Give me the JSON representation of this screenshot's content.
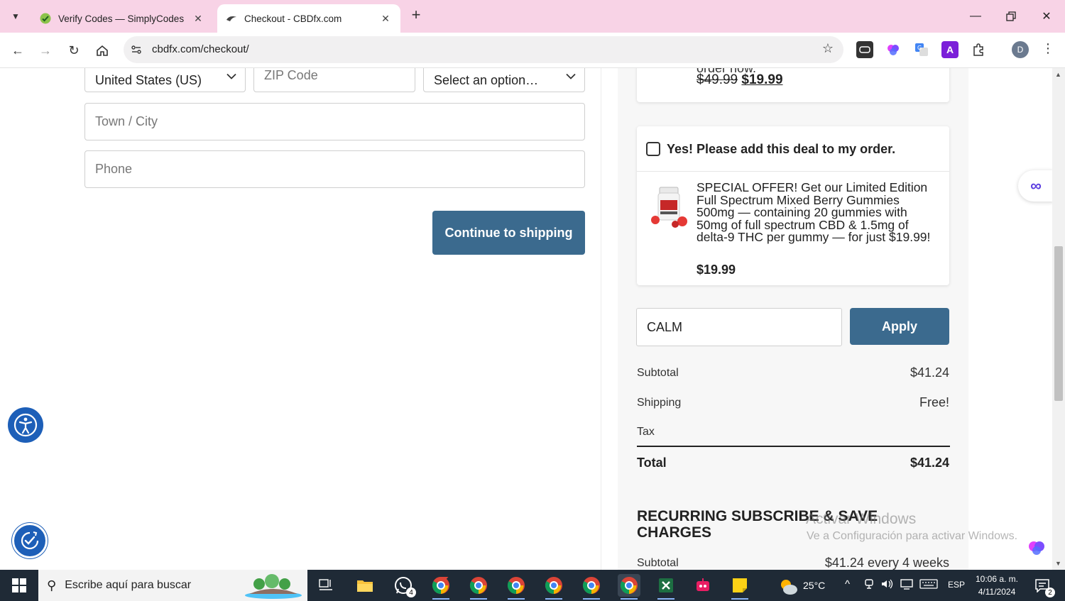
{
  "browser": {
    "tabs": [
      {
        "title": "Verify Codes — SimplyCodes",
        "active": false
      },
      {
        "title": "Checkout - CBDfx.com",
        "active": true
      }
    ],
    "url": "cbdfx.com/checkout/",
    "profile_initial": "D"
  },
  "form": {
    "country_value": "United States (US)",
    "zip_placeholder": "ZIP Code",
    "state_value": "Select an option…",
    "city_placeholder": "Town / City",
    "phone_placeholder": "Phone",
    "continue_label": "Continue to shipping"
  },
  "upsell_top": {
    "partial_text": "order now.",
    "old_price": "$49.99",
    "new_price": "$19.99"
  },
  "deal": {
    "checkbox_label": "Yes! Please add this deal to my order.",
    "description": "SPECIAL OFFER! Get our Limited Edition Full Spectrum Mixed Berry Gummies 500mg — containing 20 gummies with 50mg of full spectrum CBD & 1.5mg of delta-9 THC per gummy — for just $19.99!",
    "price": "$19.99"
  },
  "coupon": {
    "value": "CALM",
    "apply_label": "Apply"
  },
  "summary": {
    "subtotal_label": "Subtotal",
    "subtotal_value": "$41.24",
    "shipping_label": "Shipping",
    "shipping_value": "Free!",
    "tax_label": "Tax",
    "total_label": "Total",
    "total_value": "$41.24"
  },
  "recurring": {
    "title": "RECURRING SUBSCRIBE & SAVE CHARGES",
    "subtotal_label": "Subtotal",
    "subtotal_value": "$41.24 every 4 weeks"
  },
  "watermark": {
    "line1": "Activar Windows",
    "line2": "Ve a Configuración para activar Windows."
  },
  "taskbar": {
    "search_placeholder": "Escribe aquí para buscar",
    "whatsapp_badge": "4",
    "weather": "25°C",
    "language": "ESP",
    "time": "10:06 a. m.",
    "date": "4/11/2024",
    "notifications": "2"
  },
  "colors": {
    "accent": "#3b6a8e",
    "tabstrip": "#f8d3e6",
    "taskbar": "#1f2a36"
  }
}
